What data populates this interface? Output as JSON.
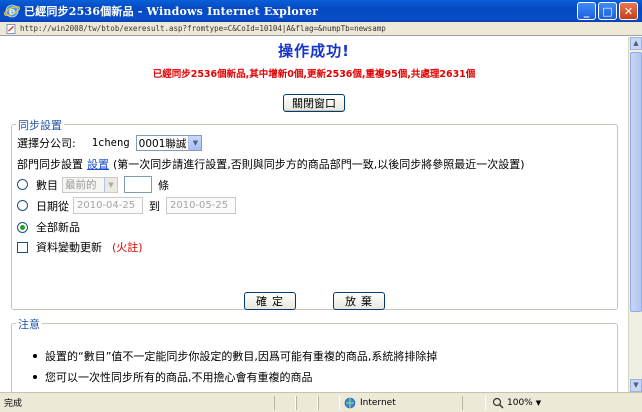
{
  "window": {
    "title": "已經同步2536個新品 - Windows Internet Explorer",
    "url": "http://win2008/tw/btob/exeresult.asp?fromtype=C&CoId=10104|A&flag=&numpTb=newsamp",
    "buttons": {
      "minimize": "_",
      "maximize": "□",
      "close": "✕"
    }
  },
  "page": {
    "heading": "操作成功!",
    "result_message": "已經同步2536個新品,其中增新0個,更新2536個,重複95個,共處理2631個",
    "close_window_button": "關閉窗口"
  },
  "sync_settings": {
    "legend": "同步設置",
    "company_label": "選擇分公司:",
    "company_code": "1cheng",
    "company_select": "0001聯誠",
    "dept_label": "部門同步設置",
    "dept_link": "設置",
    "dept_note": "(第一次同步請進行設置,否則與同步方的商品部門一致,以後同步將參照最近一次設置)",
    "option_count": {
      "label": "數目",
      "select_value": "最前的",
      "count_value": "",
      "unit": "條",
      "checked": false
    },
    "option_date": {
      "label": "日期從",
      "from_date": "2010-04-25",
      "to_label": "到",
      "to_date": "2010-05-25",
      "checked": false
    },
    "option_all": {
      "label": "全部新品",
      "checked": true
    },
    "data_change_update": {
      "label": "資料變動更新",
      "note": "(火註)",
      "checked": false
    }
  },
  "actions": {
    "confirm": "確定",
    "cancel": "放棄"
  },
  "notes": {
    "legend": "注意",
    "items": [
      "設置的“數目”值不一定能同步你設定的數目,因爲可能有重複的商品,系統將排除掉",
      "您可以一次性同步所有的商品,不用擔心會有重複的商品"
    ]
  },
  "statusbar": {
    "status": "完成",
    "zone": "Internet",
    "zoom": "100%"
  },
  "colors": {
    "titlebar": "#0548c2",
    "heading": "#1634c9",
    "result_message": "#e20000",
    "legend": "#2455a8"
  }
}
